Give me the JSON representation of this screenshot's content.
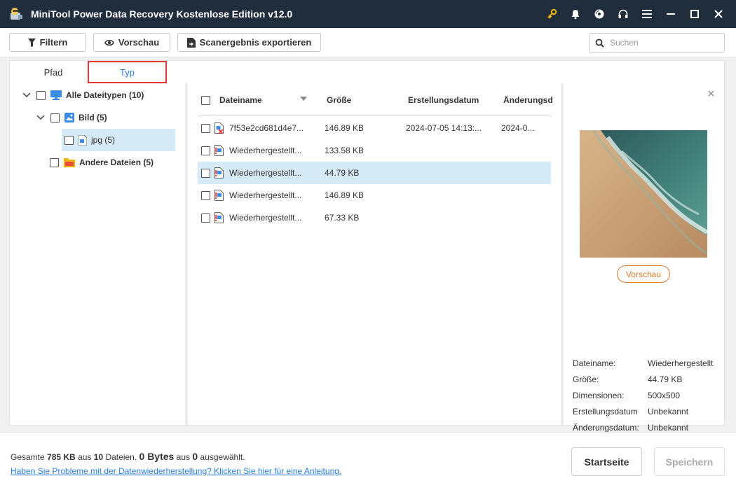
{
  "app": {
    "title": "MiniTool Power Data Recovery Kostenlose Edition v12.0",
    "icons": [
      "key-icon",
      "bell-icon",
      "disc-icon",
      "headphones-icon",
      "menu-icon",
      "minimize-icon",
      "maximize-icon",
      "close-icon"
    ]
  },
  "toolbar": {
    "filter_label": "Filtern",
    "preview_label": "Vorschau",
    "export_label": "Scanergebnis exportieren",
    "search_placeholder": "Suchen"
  },
  "tabs": {
    "path": "Pfad",
    "type": "Typ",
    "active": "Typ"
  },
  "tree": {
    "all": "Alle Dateitypen (10)",
    "image": "Bild (5)",
    "jpg": "jpg (5)",
    "other": "Andere Dateien (5)"
  },
  "list": {
    "headers": {
      "name": "Dateiname",
      "size": "Größe",
      "created": "Erstellungsdatum",
      "modified": "Änderungsd"
    },
    "rows": [
      {
        "name": "7f53e2cd681d4e7...",
        "size": "146.89 KB",
        "created": "2024-07-05 14:13:...",
        "modified": "2024-0...",
        "icon": "deleted-jpg-file-icon",
        "selected": false
      },
      {
        "name": "Wiederhergestellt...",
        "size": "133.58 KB",
        "created": "",
        "modified": "",
        "icon": "lost-jpg-file-icon",
        "selected": false
      },
      {
        "name": "Wiederhergestellt...",
        "size": "44.79 KB",
        "created": "",
        "modified": "",
        "icon": "lost-jpg-file-icon",
        "selected": true
      },
      {
        "name": "Wiederhergestellt...",
        "size": "146.89 KB",
        "created": "",
        "modified": "",
        "icon": "lost-jpg-file-icon",
        "selected": false
      },
      {
        "name": "Wiederhergestellt...",
        "size": "67.33 KB",
        "created": "",
        "modified": "",
        "icon": "lost-jpg-file-icon",
        "selected": false
      }
    ]
  },
  "preview": {
    "button_label": "Vorschau",
    "meta": {
      "name_key": "Dateiname:",
      "name_val": "Wiederhergestellt",
      "size_key": "Größe:",
      "size_val": "44.79 KB",
      "dim_key": "Dimensionen:",
      "dim_val": "500x500",
      "created_key": "Erstellungsdatum",
      "created_val": "Unbekannt",
      "modified_key": "Änderungsdatum:",
      "modified_val": "Unbekannt"
    }
  },
  "footer": {
    "stat_prefix": "Gesamte",
    "stat_total": "785 KB",
    "stat_mid": "aus",
    "stat_count": "10",
    "stat_files": "Dateien.",
    "stat_sel_bytes": "0 Bytes",
    "stat_aus": "aus",
    "stat_sel_count": "0",
    "stat_suffix": "ausgewählt.",
    "help_link": "Haben Sie Probleme mit der Datenwiederherstellung? Klicken Sie hier für eine Anleitung.",
    "home_button": "Startseite",
    "save_button": "Speichern"
  },
  "colors": {
    "titlebar": "#1f2d3d",
    "accent": "#2a7de1",
    "selection": "#d6eaf8",
    "highlight_border": "#e53935",
    "preview_button": "#e07a2f",
    "key_icon": "#f0b400"
  }
}
